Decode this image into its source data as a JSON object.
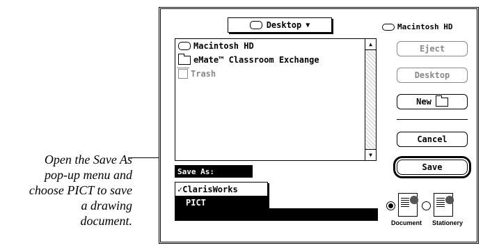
{
  "caption": {
    "lines": [
      "Open the Save As",
      "pop-up menu and",
      "choose PICT to save",
      "a drawing",
      "document."
    ]
  },
  "dialog": {
    "folder_popup": {
      "label": "Desktop",
      "arrow": "▼",
      "icon": "desktop-disk-icon"
    },
    "volume": {
      "name": "Macintosh HD",
      "icon": "hard-disk-icon"
    },
    "file_list": [
      {
        "label": "Macintosh HD",
        "icon": "hard-disk-icon"
      },
      {
        "label": "eMate™ Classroom Exchange",
        "icon": "folder-icon"
      },
      {
        "label": "Trash",
        "icon": "trash-icon",
        "dimmed": true
      }
    ],
    "buttons": {
      "eject": "Eject",
      "desktop": "Desktop",
      "new": "New",
      "cancel": "Cancel",
      "save": "Save"
    },
    "save_as": {
      "label": "Save As:",
      "options": [
        {
          "label": "ClarisWorks",
          "checked": true
        },
        {
          "label": "PICT",
          "highlighted": true
        }
      ]
    },
    "file_type": {
      "document_label": "Document",
      "stationery_label": "Stationery",
      "selected": "document"
    }
  }
}
